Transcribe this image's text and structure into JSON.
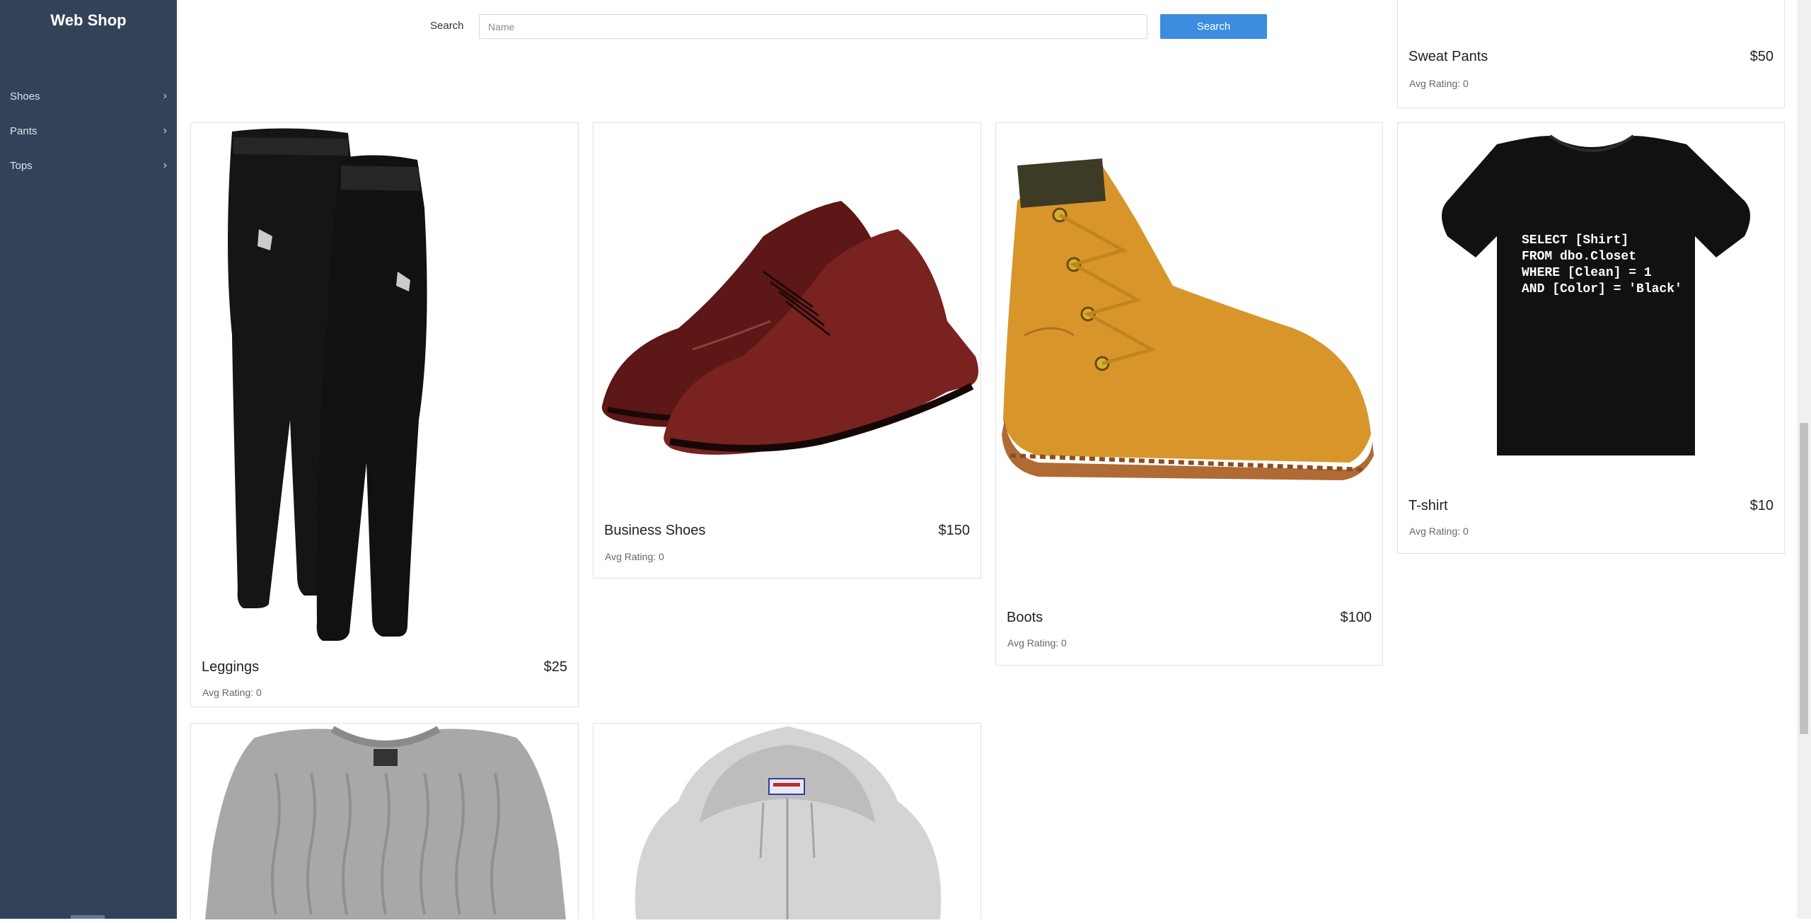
{
  "app": {
    "brand": "Web Shop"
  },
  "sidebar": {
    "items": [
      {
        "label": "Shoes",
        "chevron": "›"
      },
      {
        "label": "Pants",
        "chevron": "›"
      },
      {
        "label": "Tops",
        "chevron": "›"
      }
    ]
  },
  "header": {
    "search_label": "Search",
    "search_placeholder": "Name",
    "search_button": "Search",
    "icons": [
      "cart-icon",
      "user-icon"
    ]
  },
  "products": [
    {
      "name": "Sweat Pants",
      "price": "$50",
      "rating": "Avg Rating: 0"
    },
    {
      "name": "Leggings",
      "price": "$25",
      "rating": "Avg Rating: 0"
    },
    {
      "name": "Business Shoes",
      "price": "$150",
      "rating": "Avg Rating: 0"
    },
    {
      "name": "Boots",
      "price": "$100",
      "rating": "Avg Rating: 0"
    },
    {
      "name": "T-shirt",
      "price": "$10",
      "rating": "Avg Rating: 0",
      "shirt_text": [
        "SELECT [Shirt]",
        "FROM dbo.Closet",
        "WHERE [Clean] = 1",
        "AND [Color] = 'Black'"
      ]
    }
  ],
  "colors": {
    "sidebar": "#344259",
    "accent": "#3c8de0"
  }
}
